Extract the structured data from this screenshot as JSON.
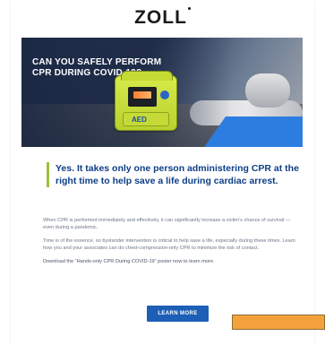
{
  "brand": {
    "logo_text": "ZOLL",
    "accent_color": "#1d5fb7",
    "highlight_color": "#f3a23b",
    "rule_color": "#9cc13b"
  },
  "hero": {
    "headline": "CAN YOU SAFELY PERFORM CPR DURING COVID-19?",
    "device_label": "AED"
  },
  "callout": {
    "text": "Yes. It takes only one person administering CPR at the right time to help save a life during cardiac arrest."
  },
  "body": {
    "para1": "When CPR is performed immediately and effectively, it can significantly increase a victim’s chance of survival — even during a pandemic.",
    "para2": "Time is of the essence, so bystander intervention is critical to help save a life, especially during these times. Learn how you and your associates can do chest-compression-only CPR to minimize the risk of contact.",
    "para3": "Download the “Hands-only CPR During COVID-19” poster now to learn more."
  },
  "cta": {
    "label": "LEARN MORE"
  }
}
